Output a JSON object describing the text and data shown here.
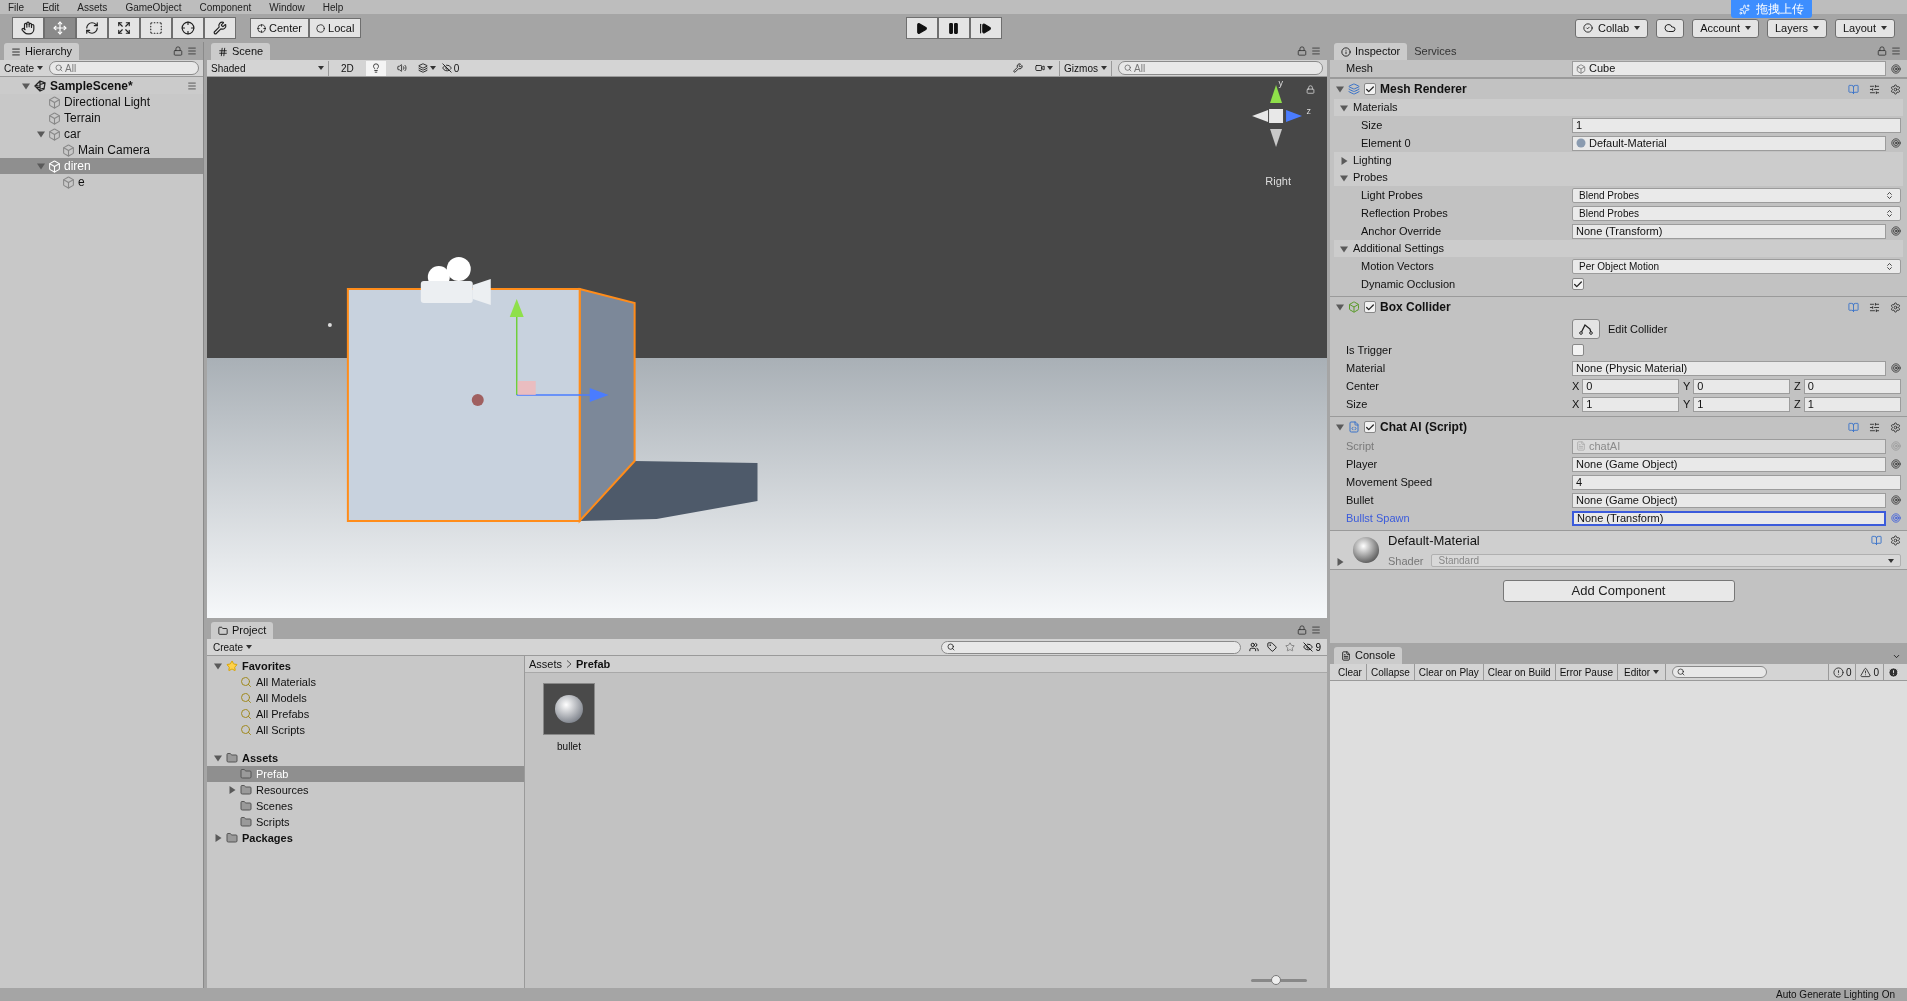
{
  "menu_bar": [
    "File",
    "Edit",
    "Assets",
    "GameObject",
    "Component",
    "Window",
    "Help"
  ],
  "toolbar": {
    "tools": [
      {
        "selected": false
      },
      {
        "selected": true
      },
      {
        "selected": false
      },
      {
        "selected": false
      },
      {
        "selected": false
      },
      {
        "selected": false
      },
      {
        "selected": false
      }
    ],
    "pivot_buttons": [
      "Center",
      "Local"
    ],
    "account_buttons": [
      "Collab",
      "Account",
      "Layers",
      "Layout"
    ]
  },
  "upload_badge": {
    "label": "拖拽上传"
  },
  "hierarchy": {
    "tab": "Hierarchy",
    "create": "Create",
    "search_placeholder": "All",
    "scene": {
      "name": "SampleScene*",
      "expanded": true,
      "items": [
        {
          "name": "Directional Light",
          "selected": false
        },
        {
          "name": "Terrain",
          "selected": false
        },
        {
          "name": "car",
          "selected": false,
          "expanded": true,
          "children": [
            {
              "name": "Main Camera",
              "selected": false
            }
          ]
        },
        {
          "name": "diren",
          "selected": true,
          "expanded": true,
          "children": [
            {
              "name": "e",
              "selected": false
            }
          ]
        }
      ]
    }
  },
  "scene": {
    "tab": "Scene",
    "shading": "Shaded",
    "mode_2d": {
      "label": "2D",
      "selected": false
    },
    "lighting_on": true,
    "audio_on": false,
    "hidden_count": "0",
    "gizmos": "Gizmos",
    "search_placeholder": "All",
    "view_label": "Right",
    "gizmo_axes": [
      "y",
      "z"
    ]
  },
  "inspector": {
    "tabs": [
      {
        "label": "Inspector",
        "selected": true
      },
      {
        "label": "Services",
        "selected": false
      }
    ],
    "mesh_filter": {
      "label": "Mesh",
      "value": "Cube"
    },
    "components": [
      {
        "title": "Mesh Renderer",
        "kind": "renderer",
        "enabled": true,
        "expanded": true,
        "rows": [
          {
            "kind": "section",
            "label": "Materials",
            "expanded": true,
            "children": [
              {
                "kind": "field",
                "label": "Size",
                "value": "1"
              },
              {
                "kind": "material_object",
                "label": "Element 0",
                "value": "Default-Material"
              }
            ]
          },
          {
            "kind": "section",
            "label": "Lighting",
            "expanded": false
          },
          {
            "kind": "section",
            "label": "Probes",
            "expanded": true,
            "children": [
              {
                "kind": "dropdown",
                "label": "Light Probes",
                "value": "Blend Probes"
              },
              {
                "kind": "dropdown",
                "label": "Reflection Probes",
                "value": "Blend Probes"
              },
              {
                "kind": "object",
                "label": "Anchor Override",
                "value": "None (Transform)"
              }
            ]
          },
          {
            "kind": "section",
            "label": "Additional Settings",
            "expanded": true,
            "children": [
              {
                "kind": "dropdown",
                "label": "Motion Vectors",
                "value": "Per Object Motion"
              },
              {
                "kind": "checkbox",
                "label": "Dynamic Occlusion",
                "checked": true
              }
            ]
          }
        ]
      },
      {
        "title": "Box Collider",
        "kind": "collider",
        "enabled": true,
        "expanded": true,
        "rows": [
          {
            "kind": "edit_button",
            "label": "Edit Collider"
          },
          {
            "kind": "checkbox",
            "label": "Is Trigger",
            "checked": false
          },
          {
            "kind": "object",
            "label": "Material",
            "value": "None (Physic Material)"
          },
          {
            "kind": "vector3",
            "label": "Center",
            "axes": [
              {
                "axis": "X",
                "value": "0"
              },
              {
                "axis": "Y",
                "value": "0"
              },
              {
                "axis": "Z",
                "value": "0"
              }
            ]
          },
          {
            "kind": "vector3",
            "label": "Size",
            "axes": [
              {
                "axis": "X",
                "value": "1"
              },
              {
                "axis": "Y",
                "value": "1"
              },
              {
                "axis": "Z",
                "value": "1"
              }
            ]
          }
        ]
      },
      {
        "title": "Chat AI (Script)",
        "kind": "script",
        "enabled": true,
        "expanded": true,
        "rows": [
          {
            "kind": "script_object",
            "label": "Script",
            "value": "chatAI",
            "disabled": true
          },
          {
            "kind": "object",
            "label": "Player",
            "value": "None (Game Object)"
          },
          {
            "kind": "field",
            "label": "Movement Speed",
            "value": "4"
          },
          {
            "kind": "object",
            "label": "Bullet",
            "value": "None (Game Object)"
          },
          {
            "kind": "object",
            "label": "Bullst Spawn",
            "value": "None (Transform)",
            "focused": true
          }
        ]
      }
    ],
    "material": {
      "name": "Default-Material",
      "shader_label": "Shader",
      "shader": "Standard",
      "expanded": false
    },
    "add_component": "Add Component"
  },
  "console": {
    "tab": "Console",
    "buttons": [
      "Clear",
      "Collapse",
      "Clear on Play",
      "Clear on Build",
      "Error Pause"
    ],
    "editor_dropdown": "Editor",
    "counts": [
      {
        "kind": "info",
        "value": "0"
      },
      {
        "kind": "warning",
        "value": "0"
      },
      {
        "kind": "error"
      }
    ]
  },
  "project": {
    "tab": "Project",
    "create": "Create",
    "hidden_count": "9",
    "tree": [
      {
        "label": "Favorites",
        "kind": "favorites",
        "selected": false,
        "expanded": true,
        "children": [
          {
            "label": "All Materials",
            "kind": "search",
            "selected": false
          },
          {
            "label": "All Models",
            "kind": "search",
            "selected": false
          },
          {
            "label": "All Prefabs",
            "kind": "search",
            "selected": false
          },
          {
            "label": "All Scripts",
            "kind": "search",
            "selected": false
          }
        ]
      },
      {
        "label": "Assets",
        "kind": "folder",
        "selected": false,
        "expanded": true,
        "children": [
          {
            "label": "Prefab",
            "kind": "folder",
            "selected": true
          },
          {
            "label": "Resources",
            "kind": "folder",
            "selected": false,
            "expanded": false
          },
          {
            "label": "Scenes",
            "kind": "folder",
            "selected": false
          },
          {
            "label": "Scripts",
            "kind": "folder",
            "selected": false
          }
        ]
      },
      {
        "label": "Packages",
        "kind": "folder",
        "selected": false,
        "expanded": false
      }
    ],
    "breadcrumb": [
      "Assets",
      "Prefab"
    ],
    "assets": [
      {
        "name": "bullet"
      }
    ],
    "zoom_slider": {
      "level": 0.45
    }
  },
  "status_bar": {
    "text": "Auto Generate Lighting On"
  }
}
